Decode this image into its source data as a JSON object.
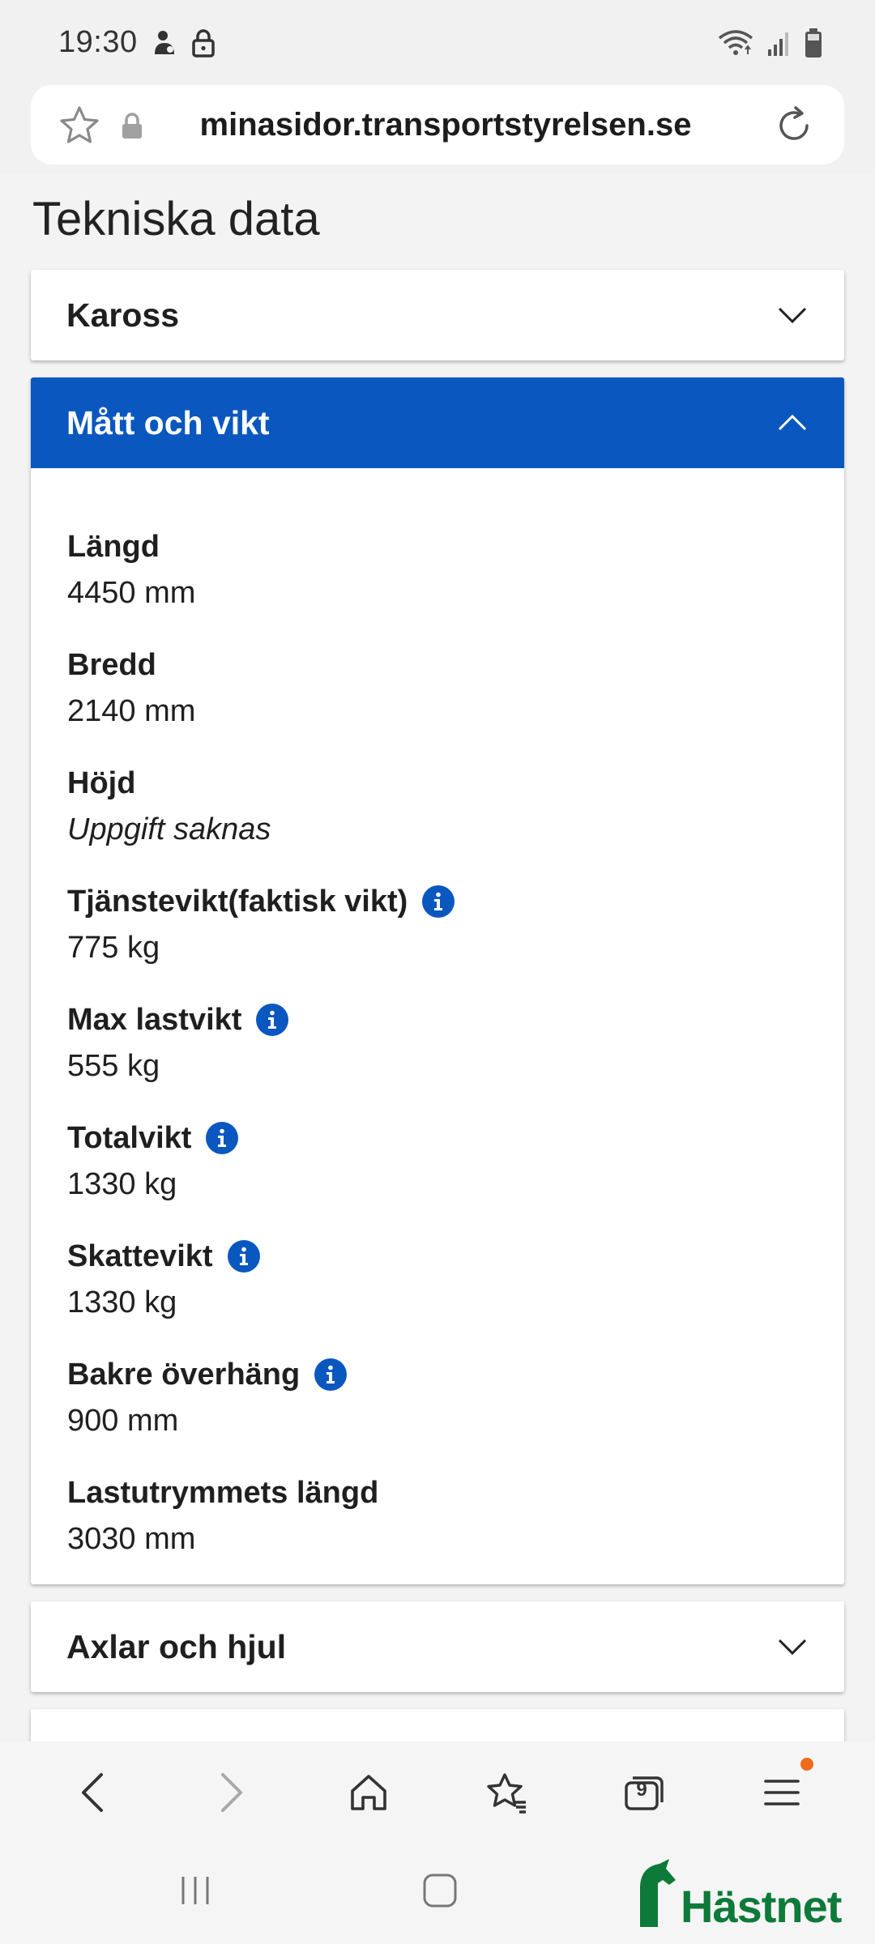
{
  "status_bar": {
    "time": "19:30"
  },
  "browser": {
    "url": "minasidor.transportstyrelsen.se"
  },
  "page": {
    "title": "Tekniska data",
    "accordions": [
      {
        "title": "Kaross",
        "expanded": false
      },
      {
        "title": "Mått och vikt",
        "expanded": true,
        "fields": [
          {
            "label": "Längd",
            "value": "4450 mm",
            "info": false
          },
          {
            "label": "Bredd",
            "value": "2140 mm",
            "info": false
          },
          {
            "label": "Höjd",
            "value": "Uppgift saknas",
            "info": false,
            "missing": true
          },
          {
            "label": "Tjänstevikt(faktisk vikt)",
            "value": "775 kg",
            "info": true
          },
          {
            "label": "Max lastvikt",
            "value": "555 kg",
            "info": true
          },
          {
            "label": "Totalvikt",
            "value": "1330 kg",
            "info": true
          },
          {
            "label": "Skattevikt",
            "value": "1330 kg",
            "info": true
          },
          {
            "label": "Bakre överhäng",
            "value": "900 mm",
            "info": true
          },
          {
            "label": "Lastutrymmets längd",
            "value": "3030 mm",
            "info": false
          }
        ]
      },
      {
        "title": "Axlar och hjul",
        "expanded": false
      }
    ]
  },
  "bottom_nav": {
    "tabs_count": "9"
  },
  "watermark": {
    "text": "Hästnet"
  },
  "colors": {
    "accent": "#0a57c0",
    "notification": "#f06a1e",
    "watermark": "#0d7a3a"
  }
}
